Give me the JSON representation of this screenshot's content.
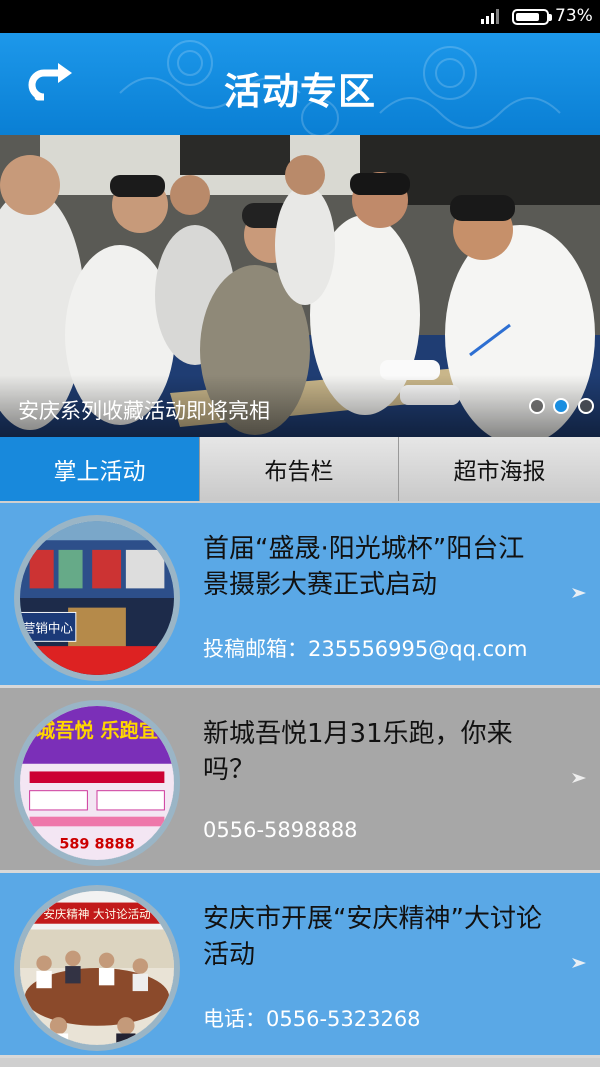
{
  "status_bar": {
    "battery_percent": "73%",
    "battery_level": 0.73
  },
  "header": {
    "title": "活动专区",
    "back_icon": "back-arrow-icon"
  },
  "banner": {
    "caption": "安庆系列收藏活动即将亮相",
    "total_slides": 3,
    "active_slide": 2
  },
  "tabs": [
    {
      "label": "掌上活动",
      "active": true
    },
    {
      "label": "布告栏",
      "active": false
    },
    {
      "label": "超市海报",
      "active": false
    }
  ],
  "items": [
    {
      "title": "首届“盛晟·阳光城杯”阳台江景摄影大赛正式启动",
      "sub": "投稿邮箱：235556995@qq.com",
      "style": "blue"
    },
    {
      "title": "新城吾悦1月31乐跑，你来吗？",
      "sub": "0556-5898888",
      "style": "gray"
    },
    {
      "title": "安庆市开展“安庆精神”大讨论活动",
      "sub": "电话：0556-5323268",
      "style": "blue"
    }
  ],
  "thumb_texts": {
    "item1_sign": "营销中心",
    "item2_banner": "新城吾悦 乐跑宜城",
    "item2_phone": "589 8888",
    "item3_banner": "安庆精神 大讨论活动"
  },
  "colors": {
    "header_blue": "#1d98ea",
    "tab_active": "#1889dc",
    "item_blue": "#5aa8e6",
    "item_gray": "#a7a7a7"
  }
}
